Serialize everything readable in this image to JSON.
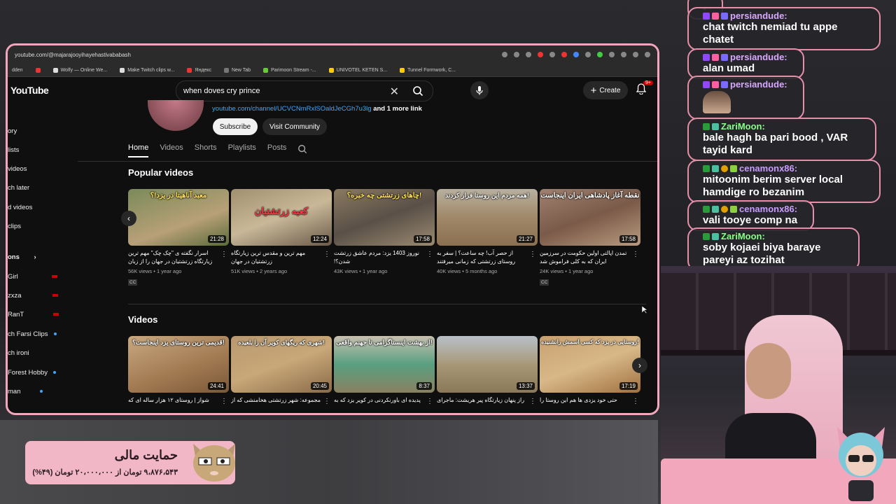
{
  "browser": {
    "url": "youtube.com/@majarajooyihayehastivababash",
    "bookmarks": [
      "dden",
      "Wolfy — Online We...",
      "Make Twitch clips w...",
      "Яндекс",
      "New Tab",
      "Parimoon Stream -...",
      "UNIVOTEL KETEN S...",
      "Tunnel Formwork, C..."
    ]
  },
  "youtube": {
    "logo": "YouTube",
    "search_value": "when doves cry prince",
    "create_label": "Create",
    "notif_badge": "9+",
    "sidebar": [
      "ory",
      "lists",
      "videos",
      "ch later",
      "d videos",
      "clips",
      "ons",
      "Girl",
      "zxza",
      "RanT",
      "ch Farsi Clips",
      "ch ironi",
      "Forest Hobby",
      "man"
    ],
    "channel_link": "youtube.com/channel/UCVCNmRxlSOaldJeCGh7u3lg",
    "channel_link_more": "and 1 more link",
    "subscribe_label": "Subscribe",
    "visit_label": "Visit Community",
    "tabs": [
      "Home",
      "Videos",
      "Shorts",
      "Playlists",
      "Posts"
    ],
    "popular_title": "Popular videos",
    "videos_title": "Videos",
    "popular": [
      {
        "overlay": "معبد آناهیتا در یزد!؟",
        "duration": "21:28",
        "title": "اسرار نگفته ی \"چک چک\" مهم ترین زیارتگاه زرتشتیان در جهان را از زبان",
        "meta": "56K views • 1 year ago",
        "cc": "CC"
      },
      {
        "overlay": "کعبه زرتشتیان",
        "duration": "12:24",
        "title": "مهم ترین و مقدس ترین زیارتگاه زرتشتیان در جهان",
        "meta": "51K views • 2 years ago",
        "cc": ""
      },
      {
        "overlay": "چاهای زرتشتی چه خبره؟!",
        "duration": "17:58",
        "title": "نوروز 1403 یزد: مردم عاشق زرتشت شدن؟!",
        "meta": "43K views • 1 year ago",
        "cc": ""
      },
      {
        "overlay": "همه مردم این روستا فرار کردند!",
        "duration": "21:27",
        "title": "از حصر آب! چه ساعت؟ | سفر به روستای زرتشتی که زمانی میرفتند",
        "meta": "40K views • 5 months ago",
        "cc": ""
      },
      {
        "overlay": "نقطه آغاز پادشاهی ایران اینجاست",
        "duration": "17:58",
        "title": "تمدن اپالتی اولین حکومت در سرزمین ایران که به کلی فراموش شد",
        "meta": "24K views • 1 year ago",
        "cc": "CC"
      }
    ],
    "videos": [
      {
        "overlay": "قدیمی ترین روستای یزد اینجاست؟!",
        "duration": "24:41",
        "title": "شواز | روستای ۱۲ هزار ساله ای که"
      },
      {
        "overlay": "شهری که ریگهای کویر آن را بلعیده!",
        "duration": "20:45",
        "title": "مجموعه: شهر زرتشتی هخامنشی که از"
      },
      {
        "overlay": "از بهشت اینستاگرامی تا جهنم واقعی!",
        "duration": "8:37",
        "title": "پدیده ای باورنکردنی در کویر یزد که به"
      },
      {
        "overlay": "",
        "duration": "13:37",
        "title": "راز پنهان زیارتگاه پیر هریشت: ماجرای"
      },
      {
        "overlay": "روستایی در یزد که کسی اسمش رانشنیده!",
        "duration": "17:19",
        "title": "حتی خود یزدی ها هم این روستا را"
      }
    ]
  },
  "chat": [
    {
      "user": "",
      "text": "-"
    },
    {
      "user": "persiandude:",
      "text": "chat twitch nemiad tu appe chatet"
    },
    {
      "user": "persiandude:",
      "text": "alan umad"
    },
    {
      "user": "persiandude:",
      "text": ""
    },
    {
      "user": "ZariMoon:",
      "text": "bale hagh ba pari bood , VAR tayid kard"
    },
    {
      "user": "cenamonx86:",
      "text": "mitoonim berim server local hamdige ro bezanim"
    },
    {
      "user": "cenamonx86:",
      "text": "vali tooye comp na"
    },
    {
      "user": "ZariMoon:",
      "text": "soby kojaei biya baraye pareyi az tozihat"
    }
  ],
  "donation": {
    "title": "حمایت مالی",
    "amount": "۹،۸۷۶،۵۴۳ تومان از ۲۰،۰۰۰،۰۰۰ تومان (۴۹%)"
  },
  "colors": {
    "accent": "#f2a7bd",
    "yt_bg": "#0f0f0f",
    "link": "#3ea6ff"
  }
}
